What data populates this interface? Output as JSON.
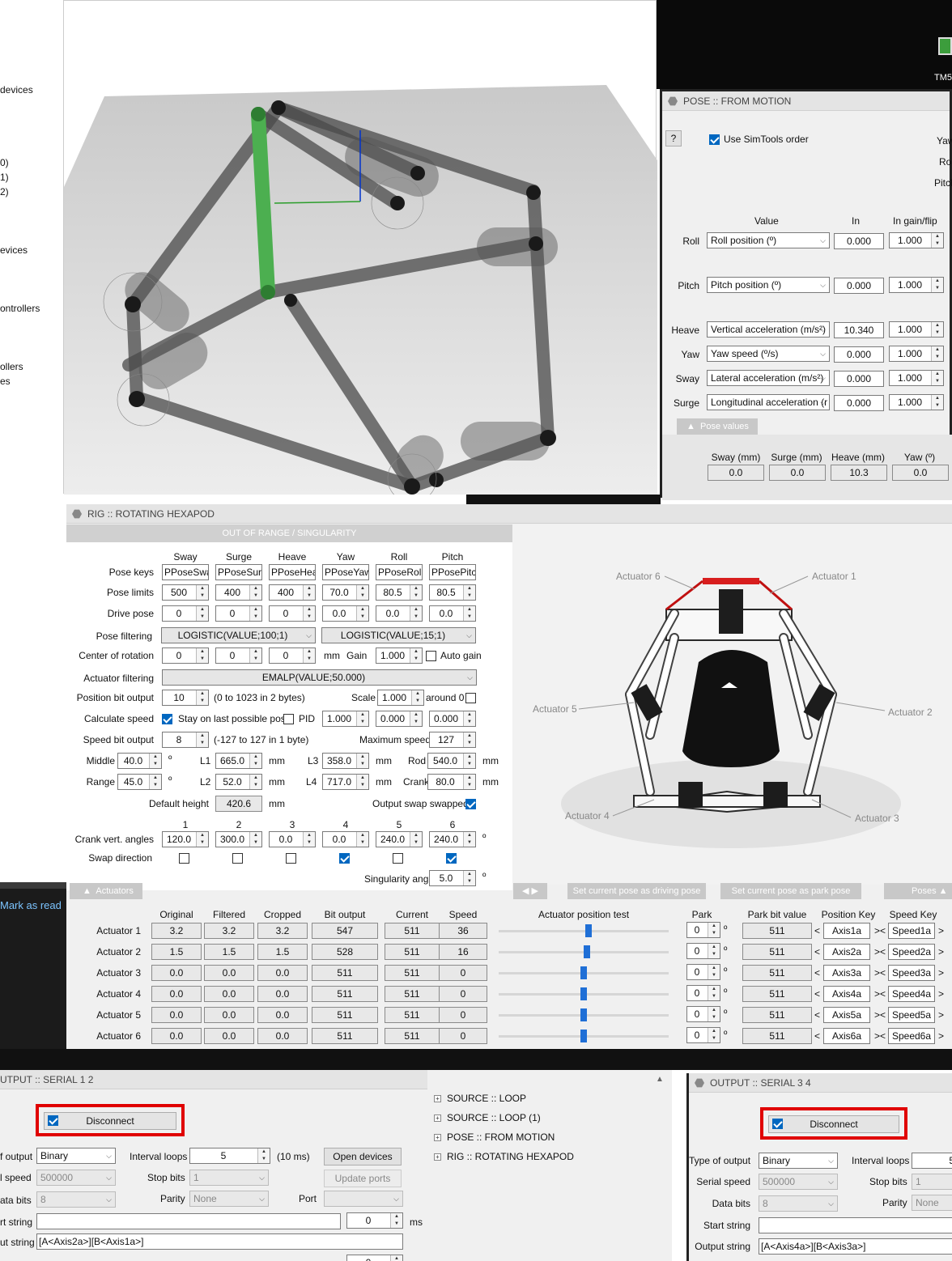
{
  "left_sidebar": {
    "items": [
      "devices",
      "0)",
      "1)",
      "2)",
      "evices",
      "ontrollers",
      "ollers",
      "es"
    ],
    "mark_as_read": "Mark as read"
  },
  "desktop_icon": {
    "label": "TM5"
  },
  "pose_panel": {
    "title": "POSE :: FROM MOTION",
    "help": "?",
    "use_simtools": "Use SimTools order",
    "use_simtools_checked": true,
    "right_labels": [
      "Yaw",
      "Roll",
      "Pitch"
    ],
    "col_headers": {
      "value": "Value",
      "in": "In",
      "gain": "In gain/flip"
    },
    "rows": [
      {
        "label": "Roll",
        "value": "Roll position (º)",
        "in": "0.000",
        "gain": "1.000"
      },
      {
        "label": "Pitch",
        "value": "Pitch position (º)",
        "in": "0.000",
        "gain": "1.000"
      },
      {
        "label": "Heave",
        "value": "Vertical acceleration (m/s²)",
        "in": "10.340",
        "gain": "1.000"
      },
      {
        "label": "Yaw",
        "value": "Yaw speed (º/s)",
        "in": "0.000",
        "gain": "1.000"
      },
      {
        "label": "Sway",
        "value": "Lateral acceleration (m/s²)",
        "in": "0.000",
        "gain": "1.000"
      },
      {
        "label": "Surge",
        "value": "Longitudinal acceleration (r",
        "in": "0.000",
        "gain": "1.000"
      }
    ],
    "pose_values_tab": "Pose values",
    "pose_cols": [
      {
        "label": "Sway (mm)",
        "value": "0.0"
      },
      {
        "label": "Surge (mm)",
        "value": "0.0"
      },
      {
        "label": "Heave (mm)",
        "value": "10.3"
      },
      {
        "label": "Yaw (º)",
        "value": "0.0"
      }
    ]
  },
  "rig_panel": {
    "title": "RIG :: ROTATING HEXAPOD",
    "banner": "OUT OF RANGE / SINGULARITY",
    "axis_headers": [
      "Sway",
      "Surge",
      "Heave",
      "Yaw",
      "Roll",
      "Pitch"
    ],
    "pose_keys_label": "Pose keys",
    "pose_keys": [
      "PPoseSway",
      "PPoseSurge",
      "PPoseHeave",
      "PPoseYaw",
      "PPoseRoll",
      "PPosePitch"
    ],
    "pose_limits_label": "Pose limits",
    "pose_limits": [
      "500",
      "400",
      "400",
      "70.0",
      "80.5",
      "80.5"
    ],
    "drive_pose_label": "Drive pose",
    "drive_pose": [
      "0",
      "0",
      "0",
      "0.0",
      "0.0",
      "0.0"
    ],
    "pose_filtering_label": "Pose filtering",
    "pose_filtering": [
      "LOGISTIC(VALUE;100;1)",
      "LOGISTIC(VALUE;15;1)"
    ],
    "center_rotation_label": "Center of rotation",
    "center_rotation": [
      "0",
      "0",
      "0"
    ],
    "mm": "mm",
    "gain_label": "Gain",
    "gain": "1.000",
    "auto_gain": "Auto gain",
    "actuator_filtering_label": "Actuator filtering",
    "actuator_filtering": "EMALP(VALUE;50.000)",
    "position_bit_output_label": "Position bit output",
    "position_bit_output": "10",
    "position_bit_range": "(0 to 1023 in 2 bytes)",
    "scale_label": "Scale",
    "scale": "1.000",
    "around_label": "around 0",
    "calculate_speed_label": "Calculate speed",
    "stay_label": "Stay on last possible pose",
    "pid_label": "PID",
    "pid_values": [
      "1.000",
      "0.000",
      "0.000"
    ],
    "speed_bit_output_label": "Speed bit output",
    "speed_bit_output": "8",
    "speed_bit_range": "(-127 to 127 in 1 byte)",
    "max_speed_label": "Maximum speed",
    "max_speed": "127",
    "middle_label": "Middle",
    "middle": "40.0",
    "range_label": "Range",
    "range": "45.0",
    "deg": "º",
    "l1_label": "L1",
    "l1": "665.0",
    "l2_label": "L2",
    "l2": "52.0",
    "l3_label": "L3",
    "l3": "358.0",
    "l4_label": "L4",
    "l4": "717.0",
    "rod_label": "Rod",
    "rod": "540.0",
    "crank_label": "Crank",
    "crank": "80.0",
    "default_height_label": "Default height",
    "default_height": "420.6",
    "output_swap_label": "Output swap swapped",
    "crank_nums": [
      "1",
      "2",
      "3",
      "4",
      "5",
      "6"
    ],
    "crank_angles_label": "Crank vert. angles",
    "crank_angles": [
      "120.0",
      "300.0",
      "0.0",
      "0.0",
      "240.0",
      "240.0"
    ],
    "swap_label": "Swap direction",
    "swap_checked": [
      false,
      false,
      false,
      true,
      false,
      true
    ],
    "singularity_label": "Singularity angle",
    "singularity": "5.0",
    "actuator_labels": [
      "Actuator 6",
      "Actuator 1",
      "Actuator 5",
      "Actuator 2",
      "Actuator 4",
      "Actuator 3"
    ],
    "actuators_tab": "Actuators",
    "set_driving": "Set current pose as driving pose",
    "set_park": "Set current pose as park pose",
    "poses_tab": "Poses",
    "act_headers": {
      "original": "Original",
      "filtered": "Filtered",
      "cropped": "Cropped",
      "bit": "Bit output",
      "current": "Current",
      "speed": "Speed",
      "test": "Actuator position test",
      "park": "Park",
      "park_bit": "Park bit value",
      "pos_key": "Position Key",
      "speed_key": "Speed Key"
    },
    "actuators": [
      {
        "name": "Actuator 1",
        "original": "3.2",
        "filtered": "3.2",
        "cropped": "3.2",
        "bit": "547",
        "current": "511",
        "speed": "36",
        "test": 0.53,
        "park": "0",
        "park_bit": "511",
        "pos_key": "Axis1a",
        "speed_key": "Speed1a"
      },
      {
        "name": "Actuator 2",
        "original": "1.5",
        "filtered": "1.5",
        "cropped": "1.5",
        "bit": "528",
        "current": "511",
        "speed": "16",
        "test": 0.52,
        "park": "0",
        "park_bit": "511",
        "pos_key": "Axis2a",
        "speed_key": "Speed2a"
      },
      {
        "name": "Actuator 3",
        "original": "0.0",
        "filtered": "0.0",
        "cropped": "0.0",
        "bit": "511",
        "current": "511",
        "speed": "0",
        "test": 0.5,
        "park": "0",
        "park_bit": "511",
        "pos_key": "Axis3a",
        "speed_key": "Speed3a"
      },
      {
        "name": "Actuator 4",
        "original": "0.0",
        "filtered": "0.0",
        "cropped": "0.0",
        "bit": "511",
        "current": "511",
        "speed": "0",
        "test": 0.5,
        "park": "0",
        "park_bit": "511",
        "pos_key": "Axis4a",
        "speed_key": "Speed4a"
      },
      {
        "name": "Actuator 5",
        "original": "0.0",
        "filtered": "0.0",
        "cropped": "0.0",
        "bit": "511",
        "current": "511",
        "speed": "0",
        "test": 0.5,
        "park": "0",
        "park_bit": "511",
        "pos_key": "Axis5a",
        "speed_key": "Speed5a"
      },
      {
        "name": "Actuator 6",
        "original": "0.0",
        "filtered": "0.0",
        "cropped": "0.0",
        "bit": "511",
        "current": "511",
        "speed": "0",
        "test": 0.5,
        "park": "0",
        "park_bit": "511",
        "pos_key": "Axis6a",
        "speed_key": "Speed6a"
      }
    ],
    "lt": "<",
    "gtlt": "><",
    "gt": ">"
  },
  "serial12": {
    "title": "UTPUT :: SERIAL 1 2",
    "disconnect": "Disconnect",
    "type_label": "f output",
    "type": "Binary",
    "interval_label": "Interval loops",
    "interval": "5",
    "interval_ms": "(10 ms)",
    "open_devices": "Open devices",
    "speed_label": "l speed",
    "speed": "500000",
    "stop_label": "Stop bits",
    "stop": "1",
    "update_ports": "Update ports",
    "data_label": "ata bits",
    "data": "8",
    "parity_label": "Parity",
    "parity": "None",
    "port_label": "Port",
    "start_label": "rt string",
    "start_ms": "0",
    "ms": "ms",
    "output_label": "ut string",
    "output": "[A<Axis2a>][B<Axis1a>]",
    "bottom_spin": "0"
  },
  "tree": {
    "items": [
      "SOURCE :: LOOP",
      "SOURCE :: LOOP (1)",
      "POSE :: FROM MOTION",
      "RIG :: ROTATING HEXAPOD"
    ]
  },
  "serial34": {
    "title": "OUTPUT :: SERIAL 3 4",
    "disconnect": "Disconnect",
    "type_label": "Type of output",
    "type": "Binary",
    "interval_label": "Interval loops",
    "interval": "5",
    "speed_label": "Serial speed",
    "speed": "500000",
    "stop_label": "Stop bits",
    "stop": "1",
    "data_label": "Data bits",
    "data": "8",
    "parity_label": "Parity",
    "parity": "None",
    "start_label": "Start string",
    "output_label": "Output string",
    "output": "[A<Axis4a>][B<Axis3a>]"
  },
  "colors": {
    "accent": "#0067c0",
    "highlight": "#e00000",
    "leg_highlight": "#4caf50"
  }
}
